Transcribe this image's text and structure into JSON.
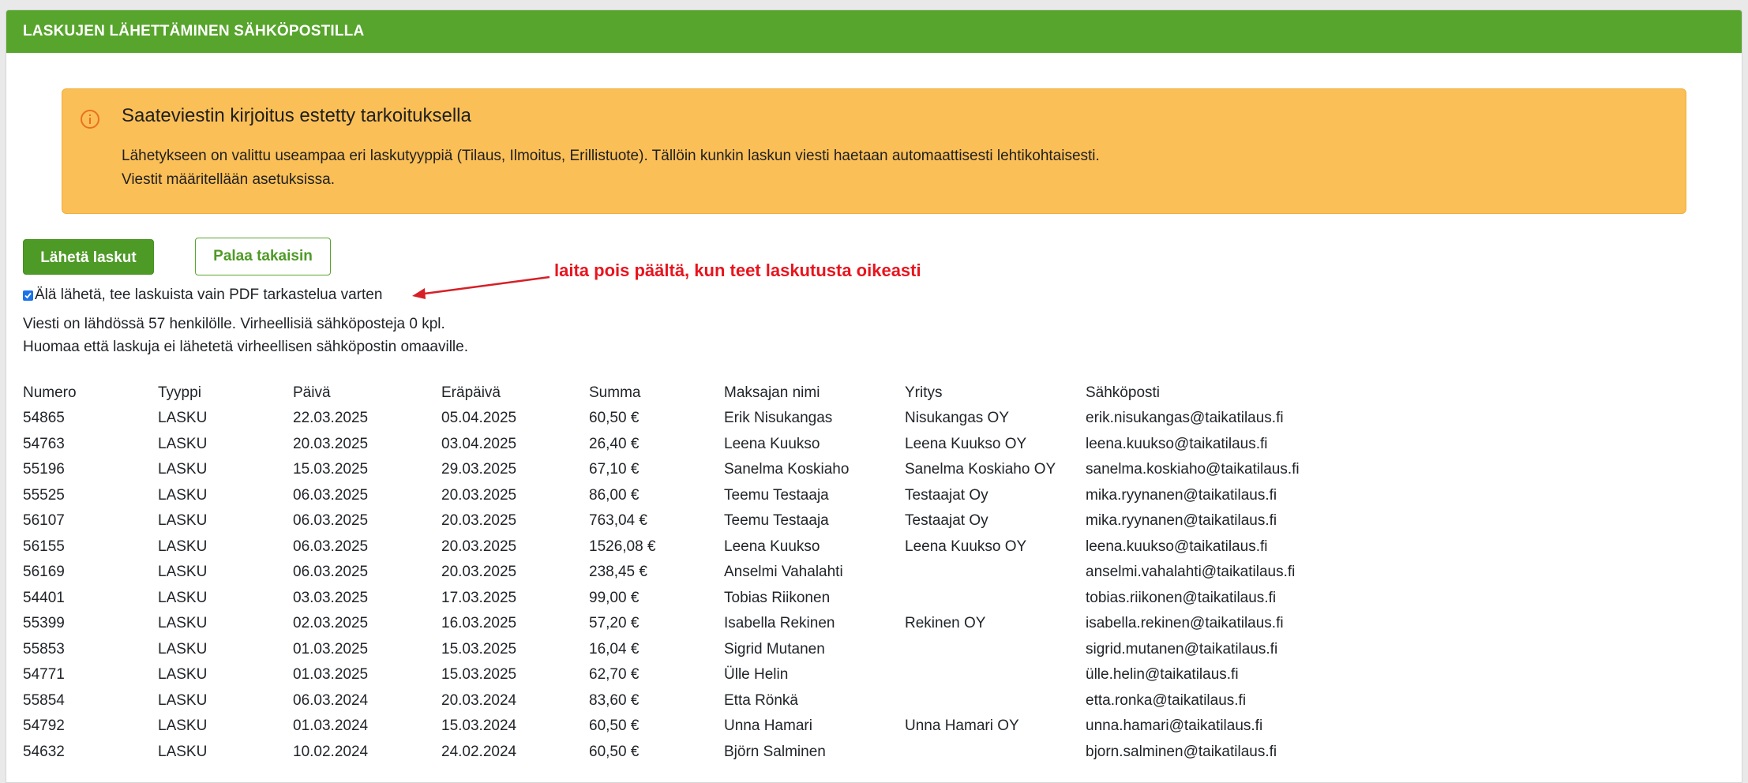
{
  "header": {
    "title": "LASKUJEN LÄHETTÄMINEN SÄHKÖPOSTILLA"
  },
  "alert": {
    "icon": "info-circle-icon",
    "title": "Saateviestin kirjoitus estetty tarkoituksella",
    "line1": "Lähetykseen on valittu useampaa eri laskutyyppiä (Tilaus, Ilmoitus, Erillistuote). Tällöin kunkin laskun viesti haetaan automaattisesti lehtikohtaisesti.",
    "line2": "Viestit määritellään asetuksissa.",
    "bg_color": "#fbbf57",
    "icon_color": "#e8731c"
  },
  "actions": {
    "send_label": "Lähetä laskut",
    "back_label": "Palaa takaisin"
  },
  "pdf_option": {
    "checked": true,
    "label": "Älä lähetä, tee laskuista vain PDF tarkastelua varten"
  },
  "annotation": {
    "text": "laita pois päältä, kun teet laskutusta oikeasti",
    "color": "#e8141e"
  },
  "info": {
    "line1": "Viesti on lähdössä 57 henkilölle. Virheellisiä sähköposteja 0 kpl.",
    "line2": "Huomaa että laskuja ei lähetetä virheellisen sähköpostin omaaville."
  },
  "table": {
    "headers": [
      "Numero",
      "Tyyppi",
      "Päivä",
      "Eräpäivä",
      "Summa",
      "Maksajan nimi",
      "Yritys",
      "Sähköposti"
    ],
    "rows": [
      [
        "54865",
        "LASKU",
        "22.03.2025",
        "05.04.2025",
        "60,50 €",
        "Erik Nisukangas",
        "Nisukangas OY",
        "erik.nisukangas@taikatilaus.fi"
      ],
      [
        "54763",
        "LASKU",
        "20.03.2025",
        "03.04.2025",
        "26,40 €",
        "Leena Kuukso",
        "Leena Kuukso OY",
        "leena.kuukso@taikatilaus.fi"
      ],
      [
        "55196",
        "LASKU",
        "15.03.2025",
        "29.03.2025",
        "67,10 €",
        "Sanelma Koskiaho",
        "Sanelma Koskiaho OY",
        "sanelma.koskiaho@taikatilaus.fi"
      ],
      [
        "55525",
        "LASKU",
        "06.03.2025",
        "20.03.2025",
        "86,00 €",
        "Teemu Testaaja",
        "Testaajat Oy",
        "mika.ryynanen@taikatilaus.fi"
      ],
      [
        "56107",
        "LASKU",
        "06.03.2025",
        "20.03.2025",
        "763,04 €",
        "Teemu Testaaja",
        "Testaajat Oy",
        "mika.ryynanen@taikatilaus.fi"
      ],
      [
        "56155",
        "LASKU",
        "06.03.2025",
        "20.03.2025",
        "1526,08 €",
        "Leena Kuukso",
        "Leena Kuukso OY",
        "leena.kuukso@taikatilaus.fi"
      ],
      [
        "56169",
        "LASKU",
        "06.03.2025",
        "20.03.2025",
        "238,45 €",
        "Anselmi Vahalahti",
        "",
        "anselmi.vahalahti@taikatilaus.fi"
      ],
      [
        "54401",
        "LASKU",
        "03.03.2025",
        "17.03.2025",
        "99,00 €",
        "Tobias Riikonen",
        "",
        "tobias.riikonen@taikatilaus.fi"
      ],
      [
        "55399",
        "LASKU",
        "02.03.2025",
        "16.03.2025",
        "57,20 €",
        "Isabella Rekinen",
        "Rekinen OY",
        "isabella.rekinen@taikatilaus.fi"
      ],
      [
        "55853",
        "LASKU",
        "01.03.2025",
        "15.03.2025",
        "16,04 €",
        "Sigrid Mutanen",
        "",
        "sigrid.mutanen@taikatilaus.fi"
      ],
      [
        "54771",
        "LASKU",
        "01.03.2025",
        "15.03.2025",
        "62,70 €",
        "Ülle Helin",
        "",
        "ülle.helin@taikatilaus.fi"
      ],
      [
        "55854",
        "LASKU",
        "06.03.2024",
        "20.03.2024",
        "83,60 €",
        "Etta Rönkä",
        "",
        "etta.ronka@taikatilaus.fi"
      ],
      [
        "54792",
        "LASKU",
        "01.03.2024",
        "15.03.2024",
        "60,50 €",
        "Unna Hamari",
        "Unna Hamari OY",
        "unna.hamari@taikatilaus.fi"
      ],
      [
        "54632",
        "LASKU",
        "10.02.2024",
        "24.02.2024",
        "60,50 €",
        "Björn Salminen",
        "",
        "bjorn.salminen@taikatilaus.fi"
      ]
    ]
  }
}
